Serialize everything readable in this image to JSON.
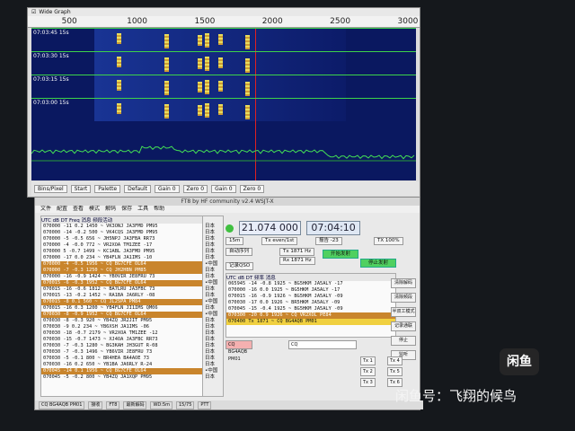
{
  "waterfall": {
    "title": "Wide Graph",
    "ticks": [
      {
        "label": "500",
        "hz": 500
      },
      {
        "label": "1000",
        "hz": 1000
      },
      {
        "label": "1500",
        "hz": 1500
      },
      {
        "label": "2000",
        "hz": 2000
      },
      {
        "label": "2500",
        "hz": 2500
      },
      {
        "label": "3000",
        "hz": 3000
      }
    ],
    "periods": [
      "07:03:45  15s",
      "07:03:30  15s",
      "07:03:15  15s",
      "07:03:00  15s"
    ],
    "signals_hz": [
      850,
      1200,
      1450,
      1500,
      1600,
      1800
    ],
    "rx_hz": 1871,
    "controls": [
      "Bins/Pixel",
      "Start",
      "Palette",
      "Default",
      "Gain 0",
      "Zero 0",
      "Gain 0",
      "Zero 0"
    ]
  },
  "main": {
    "title": "FT8  by HF community  v2.4  WSJT-X",
    "menu": [
      "文件",
      "配置",
      "查看",
      "模式",
      "解码",
      "保存",
      "工具",
      "帮助"
    ],
    "left_header": "UTC   dB   DT  Freq     消息              频段活动",
    "left_rows": [
      {
        "text": "070000 -11  0.2 1450 ~ VK3ONJ JA3FMD PM95",
        "kind": ""
      },
      {
        "text": "070000 -14 -0.2  500 ~ VK4CQS JA3FMD PM95",
        "kind": ""
      },
      {
        "text": "070000  -5 -0.5  656 ~ JH5NPJ JA3FBA RR73",
        "kind": ""
      },
      {
        "text": "070000  -4 -0.0  772 ~ VR2XOA TM1ZEE -17",
        "kind": ""
      },
      {
        "text": "070000   5 -0.7 1499 ~ KC1ABL JA3FMD PM95",
        "kind": ""
      },
      {
        "text": "070000 -17  0.0  234 ~ YB4FLN JA1IMS -10",
        "kind": ""
      },
      {
        "text": "070000  -4 -0.5 1956 ~ CQ BG7CFE OL64",
        "kind": "cq"
      },
      {
        "text": "070000  -7 -0.3 1250 ~ CQ JH2HBN PM85",
        "kind": "cq"
      },
      {
        "text": "070000 -16 -0.9 1424 ~ YB0VIR JE8FRU 73",
        "kind": ""
      },
      {
        "text": "070015  -6 -0.3 1952 ~ CQ BG7CFE OL64",
        "kind": "cq"
      },
      {
        "text": "070015 -16 -0.6 1812 ~ BA7LRU JA3FBC 73",
        "kind": ""
      },
      {
        "text": "070015 -13 -0.2 1452 ~ RA1BA JA6RLY -08",
        "kind": ""
      },
      {
        "text": "070015  -8  0.1  560 ~ CQ JL2SPA PM84",
        "kind": "cq"
      },
      {
        "text": "070015 -16  0.3 1200 ~ YB4FLN JI1IMS QM06",
        "kind": ""
      },
      {
        "text": "070030  -8 -0.9 1952 ~ CQ BG7CFE OL64",
        "kind": "cq"
      },
      {
        "text": "070030  -8 -0.3  920 ~ YB4ZQ JR2JIT PM95",
        "kind": ""
      },
      {
        "text": "070030  -9  0.2  234 ~ YB6XSH JA1IMS -06",
        "kind": ""
      },
      {
        "text": "070030 -18 -0.7 2179 ~ VR2XOA TM1ZEE -12",
        "kind": ""
      },
      {
        "text": "070030 -15 -0.7 1473 ~ XJ4OA JA3FBC RR73",
        "kind": ""
      },
      {
        "text": "070030  -7 -0.3 1280 ~ BG3KAH JH3GUT R-08",
        "kind": ""
      },
      {
        "text": "070030  -7 -0.3 1496 ~ YB6VIR JE8FRU 73",
        "kind": ""
      },
      {
        "text": "070030  -5 -0.1  800 ~ BR4HEA BA4AOE 73",
        "kind": ""
      },
      {
        "text": "070030 -16  0.2  650 ~ YB1BA JA6RLY R-24",
        "kind": ""
      },
      {
        "text": "070045 -14  0.1 1956 ~ CQ BG7CFE OL64",
        "kind": "cq"
      },
      {
        "text": "070045  -5 -0.2  800 ~ YB4ZQ JA1XQP PM95",
        "kind": ""
      }
    ],
    "countries": [
      "日本",
      "日本",
      "日本",
      "日本",
      "日本",
      "日本",
      "•中国",
      "日本",
      "日本",
      "•中国",
      "日本",
      "日本",
      "•中国",
      "日本",
      "•中国",
      "日本",
      "日本",
      "日本",
      "日本",
      "日本",
      "日本",
      "日本",
      "日本",
      "•中国",
      "日本"
    ],
    "frequency": "21.074 000",
    "utc_time": "07:04:10",
    "mode_labels": {
      "band": "15m",
      "tx_even": "Tx even/1st",
      "auto_seq": "自动序列",
      "tx_freq": "Tx 1871 Hz",
      "rx_freq": "Rx 1871 Hz",
      "report": "报告 -23",
      "tx_power": "TX 100%",
      "enable_tx": "开始发射",
      "halt_tx": "停止发射",
      "log_qso": "记录QSO"
    },
    "right_header": "UTC  dB  DT  频率  消息",
    "right_rows": [
      {
        "text": "065945 -14 -0.8 1925 ~ BG5HKM JA5ALY -17",
        "kind": ""
      },
      {
        "text": "070000 -16  0.0 1925 ~ BG5HKM JA5ALY -17",
        "kind": ""
      },
      {
        "text": "070015 -16 -0.9 1926 ~ BG5HKM JA5ALY -09",
        "kind": ""
      },
      {
        "text": "070030 -17  0.0 1926 ~ BR5HKM JA5ALY -09",
        "kind": ""
      },
      {
        "text": "070045 -15 -0.4 1925 ~ BG5HKM JA5ALY -09",
        "kind": ""
      },
      {
        "text": "070300 -20  0.9 1926 ~ CQ VR2XOL PE84",
        "kind": "cq"
      },
      {
        "text": "070400  Tx       1871 ~ CQ BG4AQB PM01",
        "kind": "tx"
      }
    ],
    "side_buttons": [
      "清除解码",
      "清除频段",
      "半双工模式",
      "记录通联",
      "停止",
      "监听"
    ],
    "tx_slots": [
      "Tx 1",
      "Tx 2",
      "Tx 3",
      "Tx 4",
      "Tx 5",
      "Tx 6"
    ],
    "tx_messages": [
      "CQ BG4AQB PM01",
      "CQ"
    ],
    "status": [
      "CQ BG4AQB PM01",
      "接收",
      "FT8",
      "最新解码",
      "WD:5m",
      "15/75",
      "PTT"
    ]
  },
  "watermark": {
    "logo": "闲鱼",
    "text": "闲鱼号：飞翔的候鸟"
  }
}
